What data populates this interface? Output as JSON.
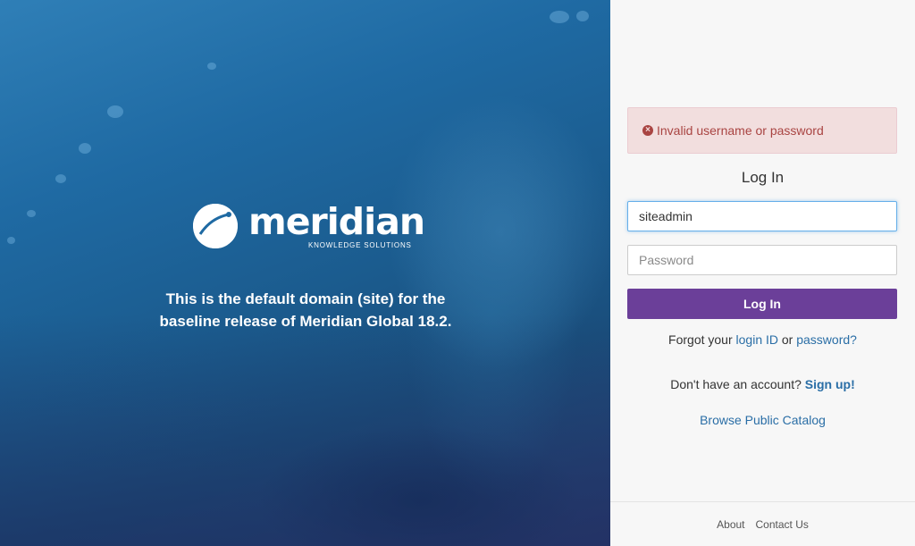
{
  "hero": {
    "brand_name": "meridian",
    "brand_subtitle": "KNOWLEDGE SOLUTIONS",
    "tagline_line1": "This is the default domain (site) for the",
    "tagline_line2": "baseline release of Meridian Global 18.2."
  },
  "login": {
    "error_icon": "error-circle-icon",
    "error_message": "Invalid username or password",
    "title": "Log In",
    "username_value": "siteadmin",
    "password_placeholder": "Password",
    "login_button": "Log In",
    "forgot_prefix": "Forgot your ",
    "forgot_login_link": "login ID",
    "forgot_or": " or ",
    "forgot_password_link": "password?",
    "no_account_text": "Don't have an account? ",
    "signup_link": "Sign up!",
    "catalog_link": "Browse Public Catalog"
  },
  "footer": {
    "about": "About",
    "contact": "Contact Us"
  },
  "colors": {
    "primary_button": "#6b3f99",
    "link": "#2a6ea6",
    "error_bg": "#f2dede",
    "error_text": "#a94442"
  }
}
